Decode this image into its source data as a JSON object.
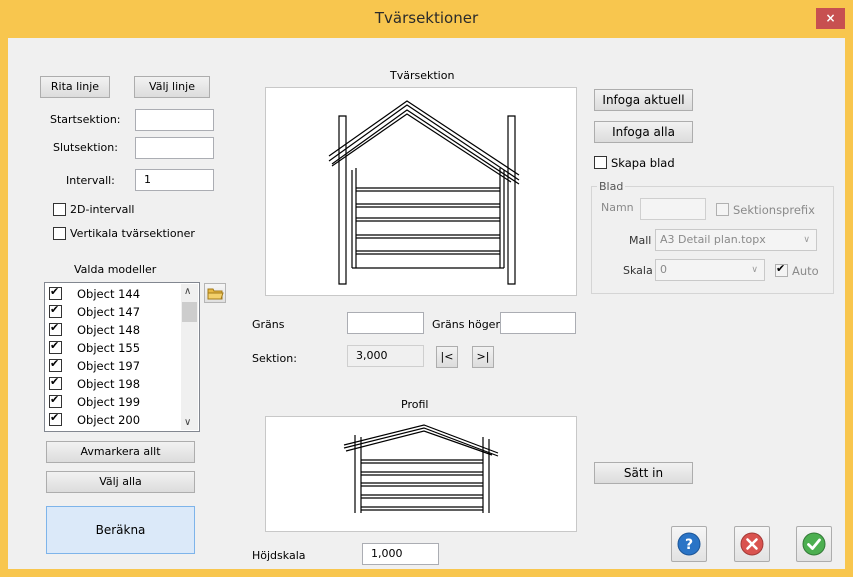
{
  "window": {
    "title": "Tvärsektioner",
    "close": "×"
  },
  "left": {
    "rita_linje": "Rita linje",
    "valj_linje": "Välj linje",
    "startsektion_label": "Startsektion:",
    "slutsektion_label": "Slutsektion:",
    "intervall_label": "Intervall:",
    "intervall_value": "1",
    "cb_2d": "2D-intervall",
    "cb_vertikala": "Vertikala tvärsektioner",
    "valda_modeller": "Valda modeller",
    "models": [
      "Object 144",
      "Object 147",
      "Object 148",
      "Object 155",
      "Object 197",
      "Object 198",
      "Object 199",
      "Object 200"
    ],
    "avmarkera": "Avmarkera allt",
    "valj_alla": "Välj alla",
    "berakna": "Beräkna"
  },
  "center": {
    "tvarsektion_title": "Tvärsektion",
    "grans_label": "Gräns",
    "grans_hoger_label": "Gräns höger",
    "sektion_label": "Sektion:",
    "sektion_value": "3,000",
    "nav_first": "|<",
    "nav_last": ">|",
    "profil_title": "Profil",
    "hojdskala_label": "Höjdskala",
    "hojdskala_value": "1,000"
  },
  "right": {
    "infoga_aktuell": "Infoga aktuell",
    "infoga_alla": "Infoga alla",
    "skapa_blad": "Skapa blad",
    "blad_group": "Blad",
    "namn_label": "Namn",
    "sektionsprefix": "Sektionsprefix",
    "mall_label": "Mall",
    "mall_value": "A3 Detail plan.topx",
    "skala_label": "Skala",
    "skala_value": "0",
    "auto": "Auto",
    "satt_in": "Sätt in"
  },
  "colors": {
    "frame": "#f8c64e",
    "close": "#c75050",
    "accent_button": "#dbe9f9",
    "help": "#2a74c6",
    "cancel": "#d9534f",
    "ok": "#4caf50"
  }
}
